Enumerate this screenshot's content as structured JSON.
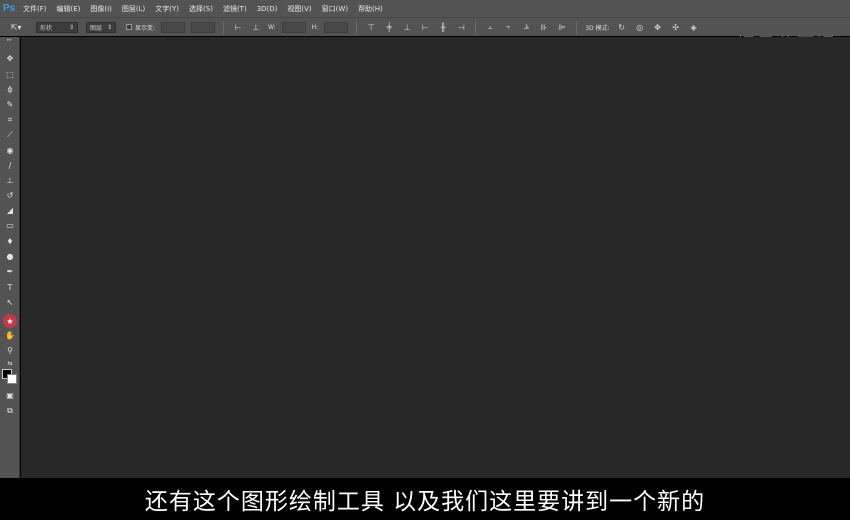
{
  "app": {
    "logo": "Ps"
  },
  "menu": [
    "文件(F)",
    "编辑(E)",
    "图像(I)",
    "图层(L)",
    "文字(Y)",
    "选择(S)",
    "滤镜(T)",
    "3D(D)",
    "视图(V)",
    "窗口(W)",
    "帮助(H)"
  ],
  "options": {
    "mode_value": "形状",
    "target_value": "图层",
    "show_label": "显示变:",
    "width_label": "W:",
    "height_label": "H:",
    "mode3d_label": "3D 模式:"
  },
  "watermark": "網易公开课",
  "subtitle": "还有这个图形绘制工具 以及我们这里要讲到一个新的",
  "colors": {
    "panel": "#535353",
    "canvas": "#282828",
    "active_tool": "#c23a4a",
    "logo": "#3aa0e8"
  }
}
